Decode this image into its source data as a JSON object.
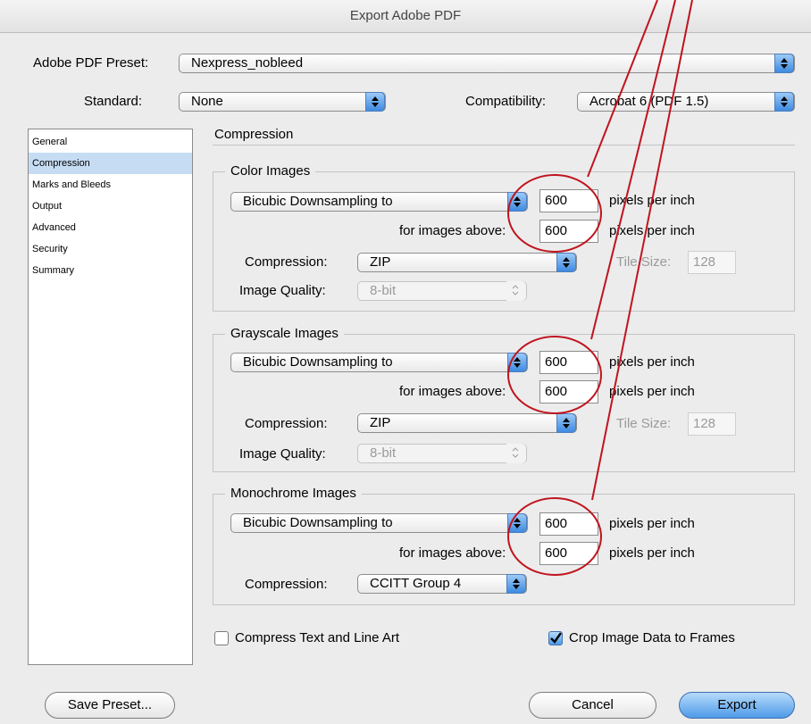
{
  "window": {
    "title": "Export Adobe PDF"
  },
  "top": {
    "preset_label": "Adobe PDF Preset:",
    "preset_value": "Nexpress_nobleed",
    "standard_label": "Standard:",
    "standard_value": "None",
    "compat_label": "Compatibility:",
    "compat_value": "Acrobat 6 (PDF 1.5)"
  },
  "sidebar": {
    "items": [
      {
        "label": "General",
        "selected": false
      },
      {
        "label": "Compression",
        "selected": true
      },
      {
        "label": "Marks and Bleeds",
        "selected": false
      },
      {
        "label": "Output",
        "selected": false
      },
      {
        "label": "Advanced",
        "selected": false
      },
      {
        "label": "Security",
        "selected": false
      },
      {
        "label": "Summary",
        "selected": false
      }
    ]
  },
  "main": {
    "section_title": "Compression",
    "color": {
      "title": "Color Images",
      "sampling": "Bicubic Downsampling to",
      "ppi": "600",
      "ppi_unit": "pixels per inch",
      "above_label": "for images above:",
      "above_value": "600",
      "above_unit": "pixels per inch",
      "compression_label": "Compression:",
      "compression_value": "ZIP",
      "tile_label": "Tile Size:",
      "tile_value": "128",
      "quality_label": "Image Quality:",
      "quality_value": "8-bit"
    },
    "gray": {
      "title": "Grayscale Images",
      "sampling": "Bicubic Downsampling to",
      "ppi": "600",
      "ppi_unit": "pixels per inch",
      "above_label": "for images above:",
      "above_value": "600",
      "above_unit": "pixels per inch",
      "compression_label": "Compression:",
      "compression_value": "ZIP",
      "tile_label": "Tile Size:",
      "tile_value": "128",
      "quality_label": "Image Quality:",
      "quality_value": "8-bit"
    },
    "mono": {
      "title": "Monochrome Images",
      "sampling": "Bicubic Downsampling to",
      "ppi": "600",
      "ppi_unit": "pixels per inch",
      "above_label": "for images above:",
      "above_value": "600",
      "above_unit": "pixels per inch",
      "compression_label": "Compression:",
      "compression_value": "CCITT Group 4"
    },
    "compress_text_label": "Compress Text and Line Art",
    "compress_text_checked": false,
    "crop_label": "Crop Image Data to Frames",
    "crop_checked": true
  },
  "buttons": {
    "save_preset": "Save Preset...",
    "cancel": "Cancel",
    "export": "Export"
  },
  "colors": {
    "annotation": "#c0141e",
    "accent": "#4e9ae8",
    "selection": "#c6dcf3"
  }
}
